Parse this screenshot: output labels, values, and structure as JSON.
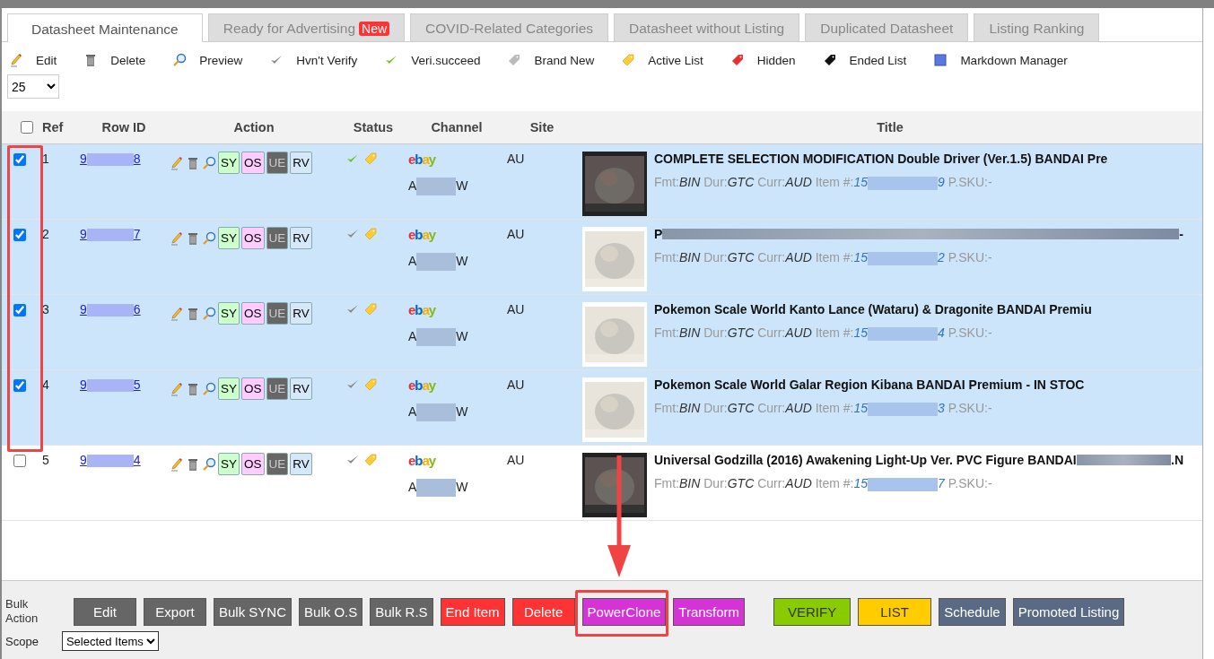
{
  "tabs": [
    {
      "label": "Datasheet Maintenance",
      "selected": true
    },
    {
      "label": "Ready for Advertising",
      "badge": "New",
      "selected": false
    },
    {
      "label": "COVID-Related Categories",
      "selected": false
    },
    {
      "label": "Datasheet without Listing",
      "selected": false
    },
    {
      "label": "Duplicated Datasheet",
      "selected": false
    },
    {
      "label": "Listing Ranking",
      "selected": false
    }
  ],
  "legend": [
    {
      "kind": "pencil",
      "label": "Edit"
    },
    {
      "kind": "trash",
      "label": "Delete"
    },
    {
      "kind": "magnifier",
      "label": "Preview"
    },
    {
      "kind": "check-grey",
      "label": "Hvn't Verify"
    },
    {
      "kind": "check-green",
      "label": "Veri.succeed"
    },
    {
      "kind": "tag-grey",
      "label": "Brand New"
    },
    {
      "kind": "tag-yellow",
      "label": "Active List"
    },
    {
      "kind": "tag-red",
      "label": "Hidden"
    },
    {
      "kind": "tag-black",
      "label": "Ended List"
    },
    {
      "kind": "square-blue",
      "label": "Markdown Manager"
    }
  ],
  "page_size": "25",
  "table": {
    "all_checked": false,
    "columns": [
      "Ref",
      "Row ID",
      "Action",
      "Status",
      "Channel",
      "Site",
      "Title"
    ],
    "rows": [
      {
        "selected": true,
        "ref": "1",
        "row_id_head": "9",
        "row_id_tail": "8",
        "verified": true,
        "channel": "ebay",
        "account_head": "A",
        "account_tail": "W",
        "site": "AU",
        "title": "COMPLETE SELECTION MODIFICATION Double Driver (Ver.1.5) BANDAI Pre",
        "fmt": "BIN",
        "dur": "GTC",
        "curr": "AUD",
        "item_head": "15",
        "item_tail": "9",
        "psku": "-"
      },
      {
        "selected": true,
        "ref": "2",
        "row_id_head": "9",
        "row_id_tail": "7",
        "verified": false,
        "channel": "ebay",
        "account_head": "A",
        "account_tail": "W",
        "site": "AU",
        "title": "P",
        "title_tail": " -",
        "fmt": "BIN",
        "dur": "GTC",
        "curr": "AUD",
        "item_head": "15",
        "item_tail": "2",
        "psku": "-"
      },
      {
        "selected": true,
        "ref": "3",
        "row_id_head": "9",
        "row_id_tail": "6",
        "verified": false,
        "channel": "ebay",
        "account_head": "A",
        "account_tail": "W",
        "site": "AU",
        "title": "Pokemon Scale World Kanto Lance (Wataru) & Dragonite BANDAI Premiu",
        "fmt": "BIN",
        "dur": "GTC",
        "curr": "AUD",
        "item_head": "15",
        "item_tail": "4",
        "psku": "-"
      },
      {
        "selected": true,
        "ref": "4",
        "row_id_head": "9",
        "row_id_tail": "5",
        "verified": false,
        "channel": "ebay",
        "account_head": "A",
        "account_tail": "W",
        "site": "AU",
        "title": "Pokemon Scale World Galar Region Kibana BANDAI Premium - IN STOC",
        "fmt": "BIN",
        "dur": "GTC",
        "curr": "AUD",
        "item_head": "15",
        "item_tail": "3",
        "psku": "-"
      },
      {
        "selected": false,
        "ref": "5",
        "row_id_head": "9",
        "row_id_tail": "4",
        "verified": false,
        "channel": "ebay",
        "account_head": "A",
        "account_tail": "W",
        "site": "AU",
        "title": "Universal Godzilla (2016) Awakening Light-Up Ver. PVC Figure BANDAI",
        "title_tail": ".N",
        "fmt": "BIN",
        "dur": "GTC",
        "curr": "AUD",
        "item_head": "15",
        "item_tail": "7",
        "psku": "-"
      }
    ],
    "row_extras": [
      {
        "actions": [
          {
            "label": "SY",
            "kind": "sync"
          },
          {
            "label": "OS",
            "kind": "os"
          },
          {
            "label": "UE",
            "kind": "ue"
          },
          {
            "label": "RV",
            "kind": "rv"
          }
        ],
        "meta_labels": {
          "fmt": "Fmt:",
          "dur": "Dur:",
          "curr": "Curr:",
          "item": "Item #:",
          "psku": "P.SKU:"
        }
      },
      {
        "actions": [
          {
            "label": "SY",
            "kind": "sync"
          },
          {
            "label": "OS",
            "kind": "os"
          },
          {
            "label": "UE",
            "kind": "ue"
          },
          {
            "label": "RV",
            "kind": "rv"
          }
        ],
        "meta_labels": {
          "fmt": "Fmt:",
          "dur": "Dur:",
          "curr": "Curr:",
          "item": "Item #:",
          "psku": "P.SKU:"
        }
      },
      {
        "actions": [
          {
            "label": "SY",
            "kind": "sync"
          },
          {
            "label": "OS",
            "kind": "os"
          },
          {
            "label": "UE",
            "kind": "ue"
          },
          {
            "label": "RV",
            "kind": "rv"
          }
        ],
        "meta_labels": {
          "fmt": "Fmt:",
          "dur": "Dur:",
          "curr": "Curr:",
          "item": "Item #:",
          "psku": "P.SKU:"
        }
      },
      {
        "actions": [
          {
            "label": "SY",
            "kind": "sync"
          },
          {
            "label": "OS",
            "kind": "os"
          },
          {
            "label": "UE",
            "kind": "ue"
          },
          {
            "label": "RV",
            "kind": "rv"
          }
        ],
        "meta_labels": {
          "fmt": "Fmt:",
          "dur": "Dur:",
          "curr": "Curr:",
          "item": "Item #:",
          "psku": "P.SKU:"
        }
      },
      {
        "actions": [
          {
            "label": "SY",
            "kind": "sync"
          },
          {
            "label": "OS",
            "kind": "os"
          },
          {
            "label": "UE",
            "kind": "ue"
          },
          {
            "label": "RV",
            "kind": "rv"
          }
        ],
        "meta_labels": {
          "fmt": "Fmt:",
          "dur": "Dur:",
          "curr": "Curr:",
          "item": "Item #:",
          "psku": "P.SKU:"
        }
      }
    ]
  },
  "bulk": {
    "label": "Bulk Action",
    "buttons": [
      {
        "label": "Edit",
        "kind": "grey"
      },
      {
        "label": "Export",
        "kind": "grey"
      },
      {
        "label": "Bulk SYNC",
        "kind": "grey"
      },
      {
        "label": "Bulk O.S",
        "kind": "grey"
      },
      {
        "label": "Bulk R.S",
        "kind": "grey"
      },
      {
        "label": "End Item",
        "kind": "red"
      },
      {
        "label": "Delete",
        "kind": "red"
      },
      {
        "label": "PowerClone",
        "kind": "magenta"
      },
      {
        "label": "Transform",
        "kind": "magenta"
      },
      {
        "label": "VERIFY",
        "kind": "green"
      },
      {
        "label": "LIST",
        "kind": "yellow"
      },
      {
        "label": "Schedule",
        "kind": "slate"
      },
      {
        "label": "Promoted Listing",
        "kind": "slate"
      }
    ],
    "scope_label": "Scope",
    "scope": "Selected Items"
  }
}
